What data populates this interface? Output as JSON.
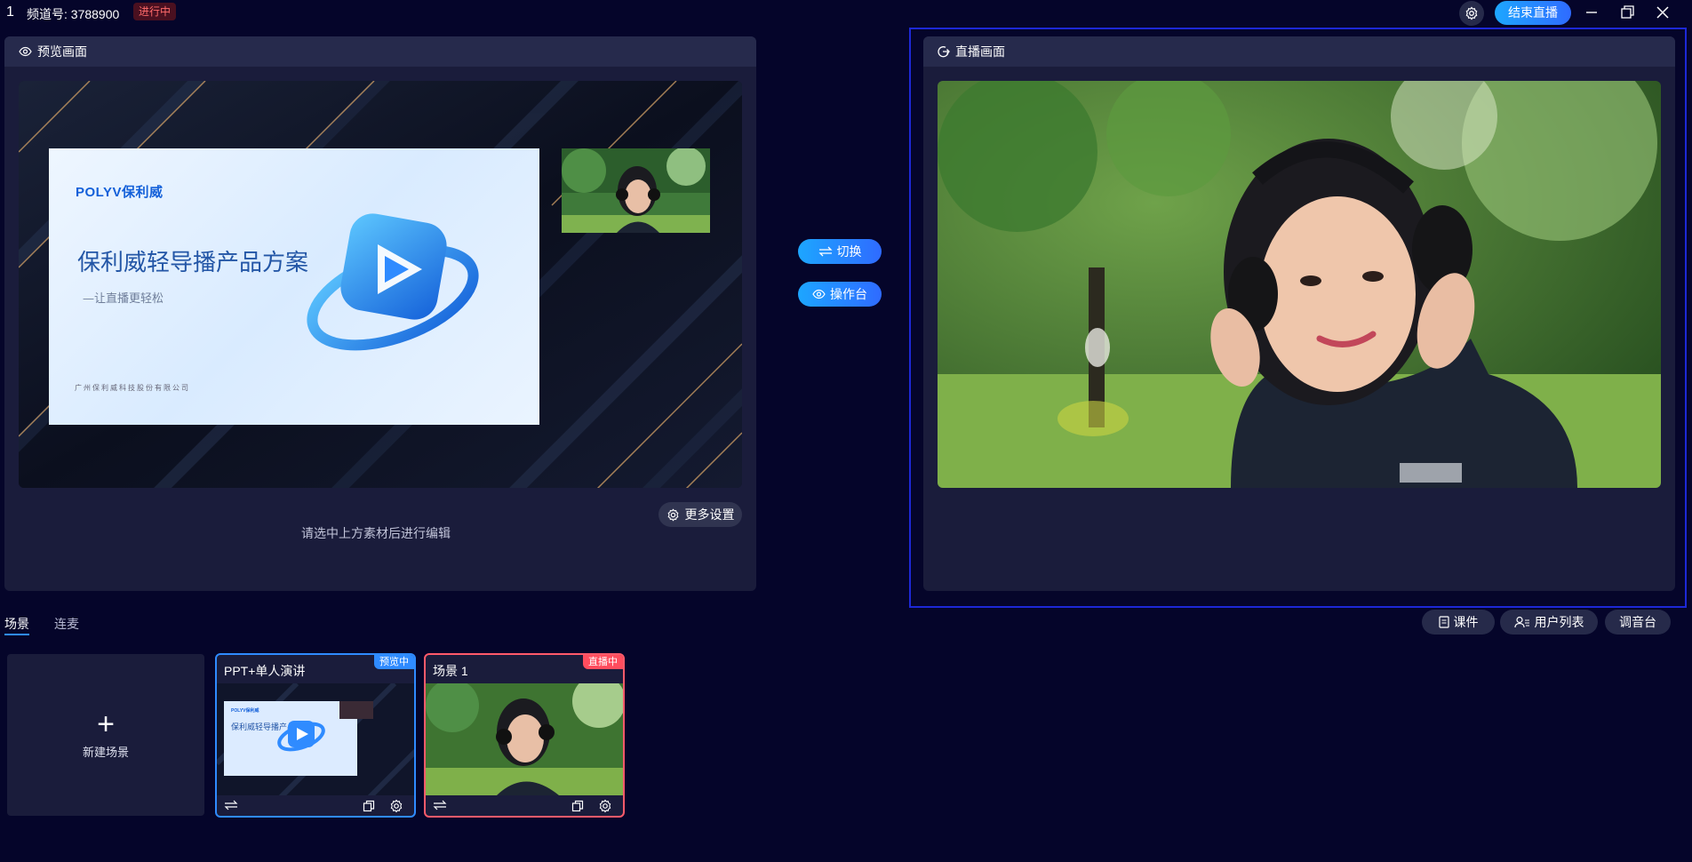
{
  "topbar": {
    "index": "1",
    "channel": "频道号: 3788900",
    "status": "进行中",
    "end_live": "结束直播"
  },
  "preview": {
    "title": "预览画面",
    "edit_hint": "请选中上方素材后进行编辑",
    "more_settings": "更多设置",
    "slide": {
      "logo": "POLYV保利威",
      "title": "保利威轻导播产品方案",
      "subtitle": "—让直播更轻松",
      "company": "广州保利威科技股份有限公司"
    }
  },
  "live": {
    "title": "直播画面"
  },
  "middle": {
    "switch": "切换",
    "console": "操作台"
  },
  "tabs": {
    "scene": "场景",
    "lianmai": "连麦"
  },
  "right_pills": {
    "course": "课件",
    "users": "用户列表",
    "mixer": "调音台"
  },
  "scenes": {
    "new_scene": "新建场景",
    "cards": [
      {
        "title": "PPT+单人演讲",
        "badge": "预览中"
      },
      {
        "title": "场景 1",
        "badge": "直播中"
      }
    ]
  },
  "colors": {
    "accent": "#2f8bff",
    "live": "#ff4d5e",
    "background": "#05052a",
    "panel": "#1a1c3b"
  }
}
